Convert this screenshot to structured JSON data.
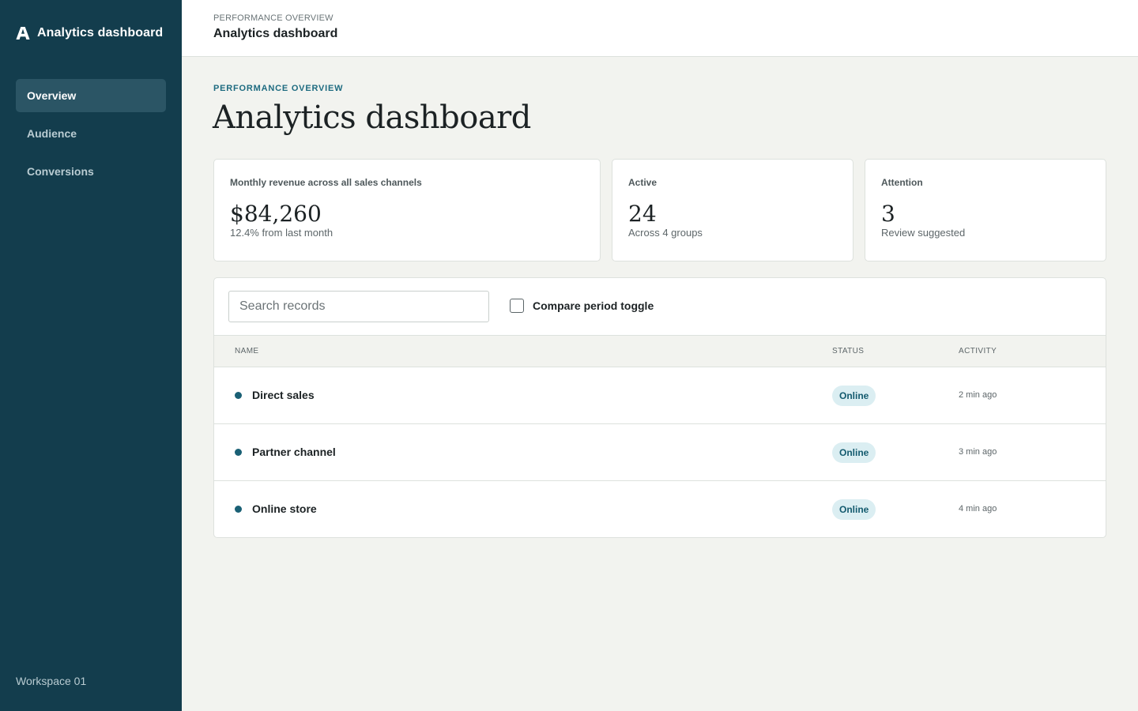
{
  "sidebar": {
    "brand_title": "Analytics dashboard",
    "logo_icon": "letter-a-logo-icon",
    "items": [
      {
        "label": "Overview",
        "active": true
      },
      {
        "label": "Audience",
        "active": false
      },
      {
        "label": "Conversions",
        "active": false
      }
    ],
    "workspace": "Workspace 01"
  },
  "topbar": {
    "eyebrow": "PERFORMANCE OVERVIEW",
    "title": "Analytics dashboard"
  },
  "main": {
    "eyebrow": "PERFORMANCE OVERVIEW",
    "title": "Analytics dashboard"
  },
  "cards": [
    {
      "label": "Monthly revenue across all sales channels",
      "value": "$84,260",
      "sub": "12.4% from last month"
    },
    {
      "label": "Active",
      "value": "24",
      "sub": "Across 4 groups"
    },
    {
      "label": "Attention",
      "value": "3",
      "sub": "Review suggested"
    }
  ],
  "toolbar": {
    "search_placeholder": "Search records",
    "search_value": "",
    "toggle_label": "Compare period toggle",
    "toggle_checked": false
  },
  "table": {
    "headers": {
      "name": "NAME",
      "status": "STATUS",
      "activity": "ACTIVITY"
    },
    "rows": [
      {
        "name": "Direct sales",
        "status": "Online",
        "activity": "2 min ago"
      },
      {
        "name": "Partner channel",
        "status": "Online",
        "activity": "3 min ago"
      },
      {
        "name": "Online store",
        "status": "Online",
        "activity": "4 min ago"
      }
    ]
  },
  "colors": {
    "sidebar_bg": "#133d4d",
    "sidebar_active": "#2b5565",
    "accent": "#1e6b80",
    "badge_bg": "#dbeef2",
    "badge_text": "#135a6e",
    "page_bg": "#f2f3ef"
  }
}
